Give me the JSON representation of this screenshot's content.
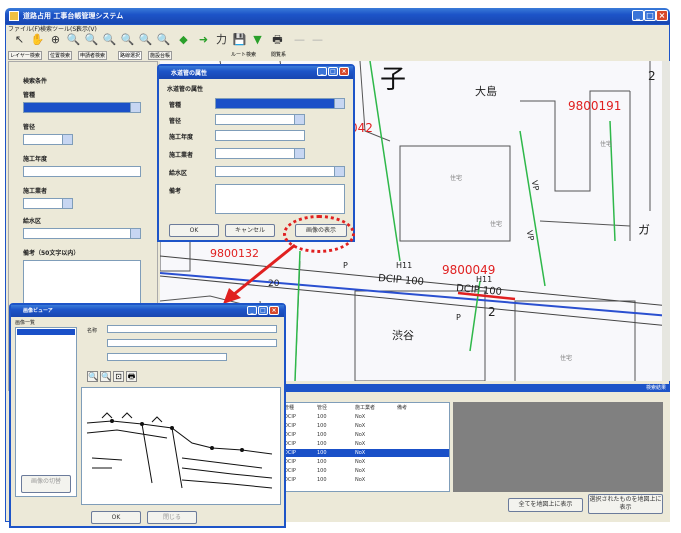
{
  "app": {
    "title": "道路占用 工事台帳管理システム",
    "menu": [
      "ファイル(F)",
      "検索ツール(S)",
      "表示(V)"
    ]
  },
  "tabs": [
    "レイヤー検索",
    "位置検索",
    "申請者検索",
    "路線選択",
    "施設台帳",
    "ルート検索",
    "閲覧系"
  ],
  "left_panel": {
    "heading": "検索条件",
    "fields": [
      {
        "label": "管種"
      },
      {
        "label": "管径"
      },
      {
        "label": "施工年度"
      },
      {
        "label": "施工業者"
      },
      {
        "label": "給水区"
      }
    ],
    "note_label": "備考（50文字以内）"
  },
  "dialog": {
    "title": "水道管の属性",
    "section": "水道管の属性",
    "labels": [
      "管種",
      "管径",
      "施工年度",
      "施工業者",
      "給水区",
      "備考"
    ],
    "ok": "OK",
    "cancel": "キャンセル",
    "show_image": "画像の表示"
  },
  "image_window": {
    "title": "画像ビューア",
    "list_header": "画像一覧",
    "props": [
      "名称",
      "",
      ""
    ],
    "tool_icons": [
      "zoom-in-icon",
      "zoom-out-icon",
      "fit-icon",
      "print-icon"
    ],
    "left_btn": "画像の切替",
    "ok": "OK",
    "close": "閉じる"
  },
  "map": {
    "kanji_big": "子",
    "area1": "大島",
    "area2": "渋谷",
    "id1": "9800191",
    "id2": "9800049",
    "id3": "042",
    "id4": "9800132",
    "pipe_label": "DCIP 100",
    "pipe_label2": "DCIP 100",
    "h11": "H11",
    "h11b": "H11",
    "num2a": "2",
    "num2b": "2",
    "num20": "20",
    "ga": "ガ",
    "vp_a": "VP",
    "vp_b": "VP",
    "pp": "P",
    "ppb": "P",
    "bldg1": "住宅",
    "bldg2": "住宅",
    "bldg3": "住宅",
    "bldg4": "住宅"
  },
  "results": {
    "header": [
      "管種",
      "管径",
      "施工業者",
      "備考"
    ],
    "rows": [
      [
        "DCIP",
        "100",
        "NoX"
      ],
      [
        "DCIP",
        "100",
        "NoX"
      ],
      [
        "DCIP",
        "100",
        "NoX"
      ],
      [
        "DCIP",
        "100",
        "NoX"
      ],
      [
        "DCIP",
        "100",
        "NoX"
      ],
      [
        "DCIP",
        "100",
        "NoX"
      ],
      [
        "DCIP",
        "100",
        "NoX"
      ],
      [
        "DCIP",
        "100",
        "NoX"
      ]
    ],
    "btn_all": "全てを地図上に表示",
    "btn_sel": "選択されたものを地図上に表示",
    "label_top": "検索結果"
  },
  "colors": {
    "title_blue": "#1d54c8",
    "red": "#e02020",
    "pipe_blue": "#2a4fd0",
    "green": "#2fb84a",
    "highlight": "#1a50c8"
  }
}
